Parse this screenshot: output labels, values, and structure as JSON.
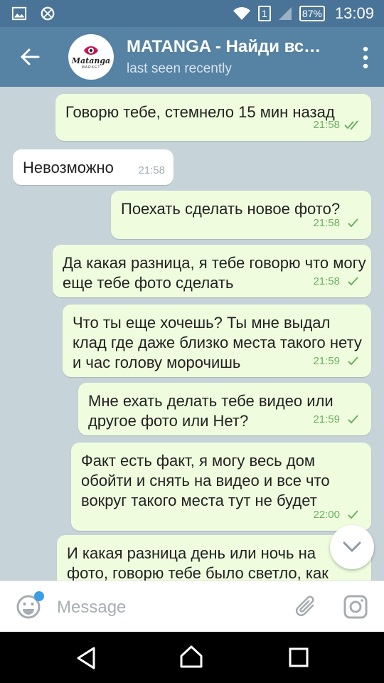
{
  "status_bar": {
    "battery": "87%",
    "sim": "1",
    "time": "13:09"
  },
  "header": {
    "title": "MATANGA - Найди вс…",
    "subtitle": "last seen recently",
    "avatar_logo_text": "Matanga",
    "avatar_logo_sub": "MARKET"
  },
  "messages": [
    {
      "direction": "out",
      "text": "Говорю тебе, стемнело 15 мин назад",
      "time": "21:58",
      "status": "read"
    },
    {
      "direction": "in",
      "text": "Невозможно",
      "time": "21:58"
    },
    {
      "direction": "out",
      "text": "Поехать сделать новое фото?",
      "time": "21:58",
      "status": "sent"
    },
    {
      "direction": "out",
      "text": "Да какая разница, я тебе говорю что могу еще тебе фото сделать",
      "time": "21:58",
      "status": "sent"
    },
    {
      "direction": "out",
      "text": "Что ты еще хочешь? Ты мне выдал клад где даже близко места такого нету и час голову морочишь",
      "time": "21:59",
      "status": "sent"
    },
    {
      "direction": "out",
      "text": "Мне ехать делать тебе видео или другое фото или Нет?",
      "time": "21:59",
      "status": "sent"
    },
    {
      "direction": "out",
      "text": "Факт есть факт, я могу весь дом обойти и снять на видео и все что вокруг такого места тут не будет",
      "time": "22:00",
      "status": "sent"
    },
    {
      "direction": "out",
      "text": "И какая разница день или ночь на фото, говорю тебе было светло, как",
      "time": "",
      "status": ""
    }
  ],
  "input": {
    "placeholder": "Message",
    "value": ""
  },
  "icons": {
    "back": "arrow-left-icon",
    "menu": "more-vert-icon",
    "emoji": "emoji-icon",
    "attach": "paperclip-icon",
    "camera": "instagram-camera-icon",
    "scroll": "chevron-down-icon"
  },
  "colors": {
    "header": "#5682a3",
    "status_bar": "#4a7497",
    "outgoing_bubble": "#effdde",
    "incoming_bubble": "#ffffff",
    "check": "#6cb162"
  }
}
